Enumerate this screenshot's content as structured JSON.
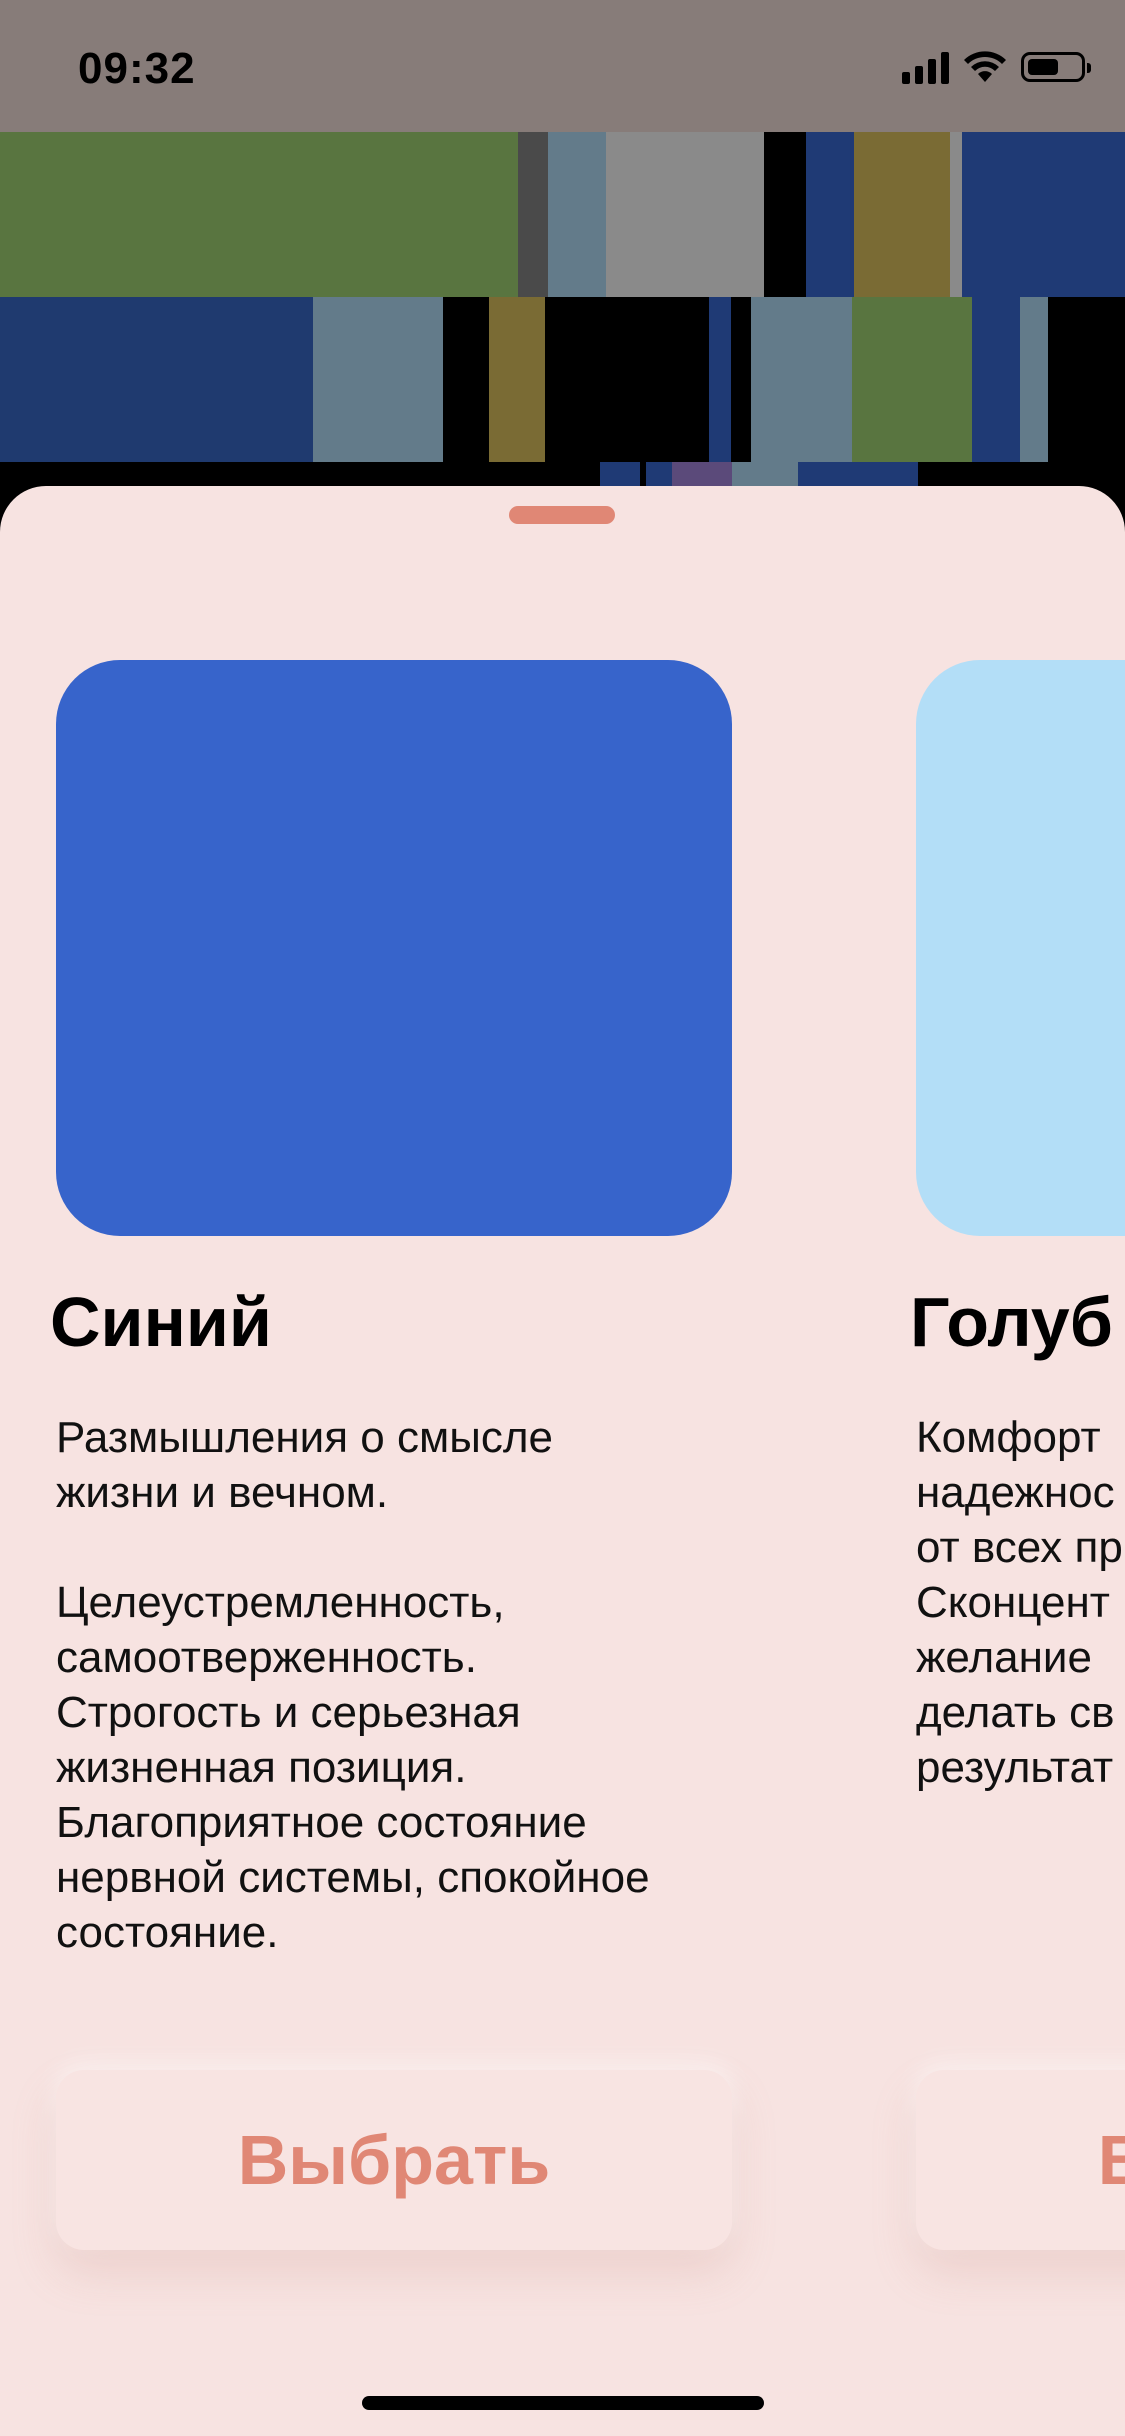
{
  "status_bar": {
    "time": "09:32"
  },
  "colors": {
    "accent": "#e08775",
    "sheet_background": "#f7e3e1",
    "status_bar": "#877c79"
  },
  "cards": [
    {
      "title": "Синий",
      "swatch_color": "#3764cb",
      "description": "Размышления о смысле\nжизни и вечном.\n\nЦелеустремленность,\nсамоотверженность.\nСтрогость и серьезная\nжизненная позиция.\nБлагоприятное состояние\nнервной системы, спокойное\nсостояние.",
      "button_label": "Выбрать"
    },
    {
      "title": "Голуб",
      "swatch_color": "#b3def7",
      "description": "Комфорт\nнадежнос\nот всех пр\nСконцент\nжелание\nделать св\nрезультат",
      "button_label": "Выбрать"
    }
  ]
}
